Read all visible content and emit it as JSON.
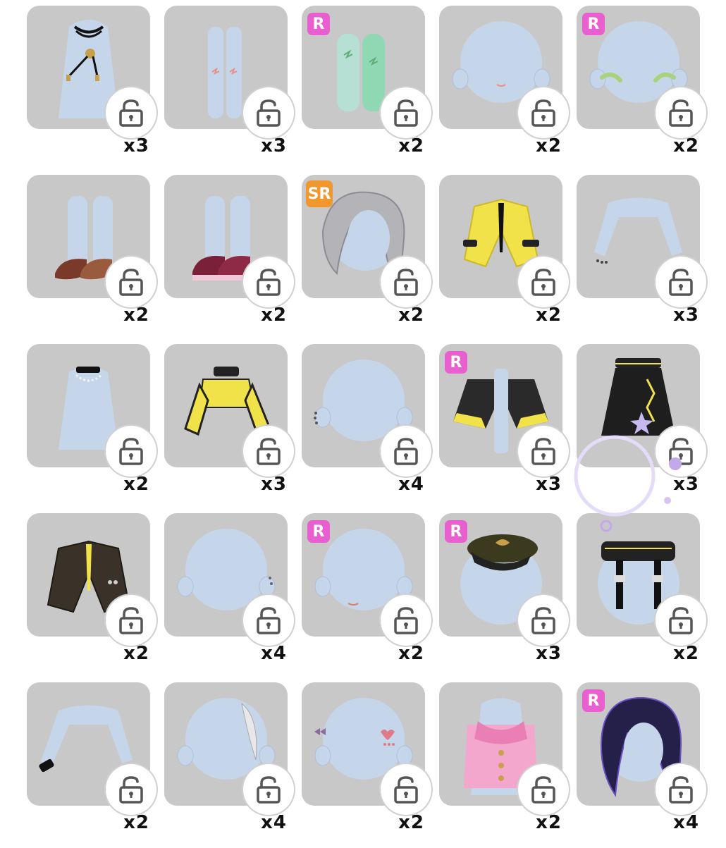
{
  "items": [
    {
      "name": "necklace-cord",
      "badge": "",
      "count": "x3"
    },
    {
      "name": "leggings-socks",
      "badge": "",
      "count": "x3"
    },
    {
      "name": "green-boots",
      "badge": "R",
      "count": "x2"
    },
    {
      "name": "blush-face",
      "badge": "",
      "count": "x2"
    },
    {
      "name": "green-eyebrows",
      "badge": "R",
      "count": "x2"
    },
    {
      "name": "brown-loafers",
      "badge": "",
      "count": "x2"
    },
    {
      "name": "burgundy-mary-janes",
      "badge": "",
      "count": "x2"
    },
    {
      "name": "silver-hair",
      "badge": "SR",
      "count": "x2"
    },
    {
      "name": "yellow-jacket-tie",
      "badge": "",
      "count": "x2"
    },
    {
      "name": "bracelet-arms",
      "badge": "",
      "count": "x3"
    },
    {
      "name": "choker-pearl",
      "badge": "",
      "count": "x2"
    },
    {
      "name": "yellow-black-top",
      "badge": "",
      "count": "x3"
    },
    {
      "name": "ear-piercing",
      "badge": "",
      "count": "x4"
    },
    {
      "name": "black-yellow-cape",
      "badge": "R",
      "count": "x3"
    },
    {
      "name": "black-skirt",
      "badge": "",
      "count": "x3"
    },
    {
      "name": "black-blazer-tie",
      "badge": "",
      "count": "x2"
    },
    {
      "name": "ear-stud",
      "badge": "",
      "count": "x4"
    },
    {
      "name": "mouth-detail",
      "badge": "R",
      "count": "x2"
    },
    {
      "name": "officer-cap",
      "badge": "R",
      "count": "x3"
    },
    {
      "name": "belted-hat",
      "badge": "",
      "count": "x2"
    },
    {
      "name": "wrist-cuff",
      "badge": "",
      "count": "x2"
    },
    {
      "name": "hair-clip-strand",
      "badge": "",
      "count": "x4"
    },
    {
      "name": "face-stickers",
      "badge": "",
      "count": "x2"
    },
    {
      "name": "pink-bow-top",
      "badge": "",
      "count": "x2"
    },
    {
      "name": "dark-purple-hair",
      "badge": "R",
      "count": "x4"
    }
  ]
}
